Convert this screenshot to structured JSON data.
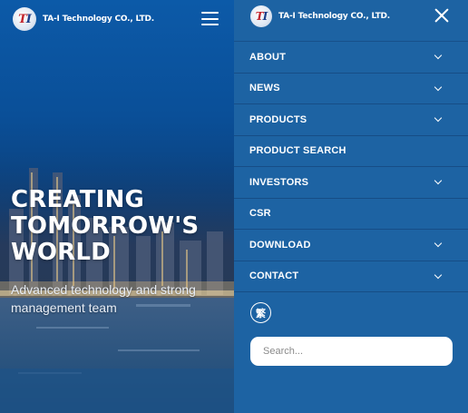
{
  "brand": {
    "company_name": "TA-I Technology CO., LTD.",
    "logo_letters": "T",
    "logo_letters_b": "I"
  },
  "hero": {
    "headline_lines": [
      "CREATING",
      "TOMORROW'S",
      "WORLD"
    ],
    "subline_lines": [
      "Advanced technology and strong",
      "management team"
    ],
    "menu_icon": "hamburger-menu-icon"
  },
  "menu": {
    "close_icon": "close-icon",
    "items": [
      {
        "label": "ABOUT",
        "has_submenu": true
      },
      {
        "label": "NEWS",
        "has_submenu": true
      },
      {
        "label": "PRODUCTS",
        "has_submenu": true
      },
      {
        "label": "PRODUCT SEARCH",
        "has_submenu": false
      },
      {
        "label": "INVESTORS",
        "has_submenu": true
      },
      {
        "label": "CSR",
        "has_submenu": false
      },
      {
        "label": "DOWNLOAD",
        "has_submenu": true
      },
      {
        "label": "CONTACT",
        "has_submenu": true
      }
    ],
    "language_button": "繁",
    "search_placeholder": "Search..."
  },
  "colors": {
    "menu_bg": "#1d63a3",
    "menu_divider": "#164d86",
    "hero_blue": "#0c5aa8",
    "logo_red": "#c2242c"
  }
}
